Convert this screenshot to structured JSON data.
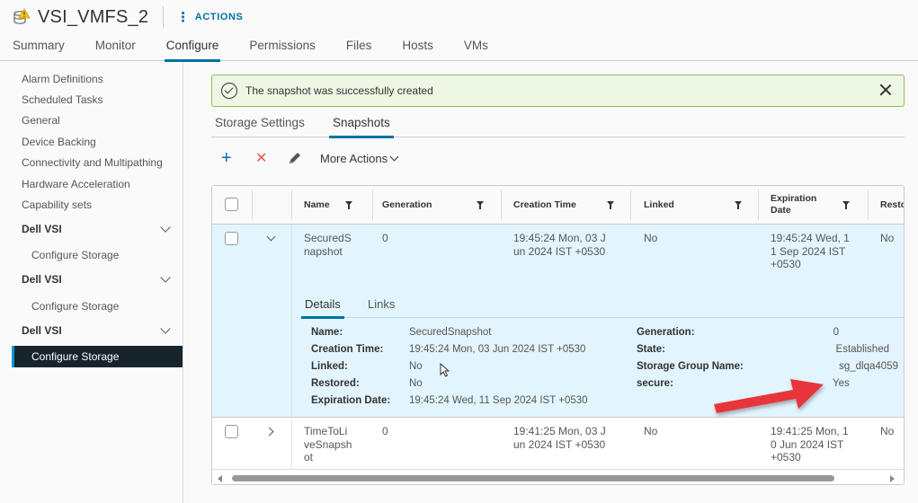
{
  "header": {
    "title": "VSI_VMFS_2",
    "title_icon": "datastore-warning-icon",
    "actions_label": "ACTIONS"
  },
  "nav_tabs": [
    {
      "label": "Summary",
      "active": false
    },
    {
      "label": "Monitor",
      "active": false
    },
    {
      "label": "Configure",
      "active": true
    },
    {
      "label": "Permissions",
      "active": false
    },
    {
      "label": "Files",
      "active": false
    },
    {
      "label": "Hosts",
      "active": false
    },
    {
      "label": "VMs",
      "active": false
    }
  ],
  "sidebar": {
    "items": [
      "Alarm Definitions",
      "Scheduled Tasks",
      "General",
      "Device Backing",
      "Connectivity and Multipathing",
      "Hardware Acceleration",
      "Capability sets"
    ],
    "groups": [
      {
        "label": "Dell VSI",
        "sub": "Configure Storage",
        "selected": false
      },
      {
        "label": "Dell VSI",
        "sub": "Configure Storage",
        "selected": false
      },
      {
        "label": "Dell VSI",
        "sub": "Configure Storage",
        "selected": true
      }
    ]
  },
  "alert": {
    "message": "The snapshot was successfully created",
    "type": "success"
  },
  "sub_tabs": [
    {
      "label": "Storage Settings",
      "active": false
    },
    {
      "label": "Snapshots",
      "active": true
    }
  ],
  "toolbar": {
    "add_icon": "+",
    "delete_icon": "✕",
    "more_actions_label": "More Actions"
  },
  "grid": {
    "columns": [
      "Name",
      "Generation",
      "Creation Time",
      "Linked",
      "Expiration Date",
      "Resto"
    ],
    "rows": [
      {
        "name": "SecuredS napshot",
        "name_lines": [
          "SecuredS",
          "napshot"
        ],
        "generation": "0",
        "creation_lines": [
          "19:45:24 Mon, 03 J",
          "un 2024 IST +0530"
        ],
        "linked": "No",
        "expiration_lines": [
          "19:45:24 Wed, 1",
          "1 Sep 2024 IST",
          "+0530"
        ],
        "restored": "No",
        "expanded": true
      },
      {
        "name": "TimeToLiveSnapshot",
        "name_lines": [
          "TimeToLi",
          "veSnapsh",
          "ot"
        ],
        "generation": "0",
        "creation_lines": [
          "19:41:25 Mon, 03 J",
          "un 2024 IST +0530"
        ],
        "linked": "No",
        "expiration_lines": [
          "19:41:25 Mon, 1",
          "0 Jun 2024 IST",
          "+0530"
        ],
        "restored": "No",
        "expanded": false
      }
    ],
    "detail": {
      "tabs": [
        {
          "label": "Details",
          "active": true
        },
        {
          "label": "Links",
          "active": false
        }
      ],
      "left": [
        {
          "label": "Name:",
          "value": "SecuredSnapshot"
        },
        {
          "label": "Creation Time:",
          "value": "19:45:24 Mon, 03 Jun 2024 IST +0530"
        },
        {
          "label": "Linked:",
          "value": "No"
        },
        {
          "label": "Restored:",
          "value": "No"
        },
        {
          "label": "Expiration Date:",
          "value": "19:45:24 Wed, 11 Sep 2024 IST +0530"
        }
      ],
      "right": [
        {
          "label": "Generation:",
          "value": "0"
        },
        {
          "label": "State:",
          "value": "Established"
        },
        {
          "label": "Storage Group Name:",
          "value": "sg_dlqa4059"
        },
        {
          "label": "secure:",
          "value": "Yes"
        }
      ]
    }
  },
  "colors": {
    "accent": "#0072a3",
    "success_bg": "#eef7e4",
    "success_border": "#8cbc5c",
    "selected_row": "#e2f4fd",
    "sidebar_selected": "#17242d",
    "annotation_arrow": "#e8353a"
  }
}
